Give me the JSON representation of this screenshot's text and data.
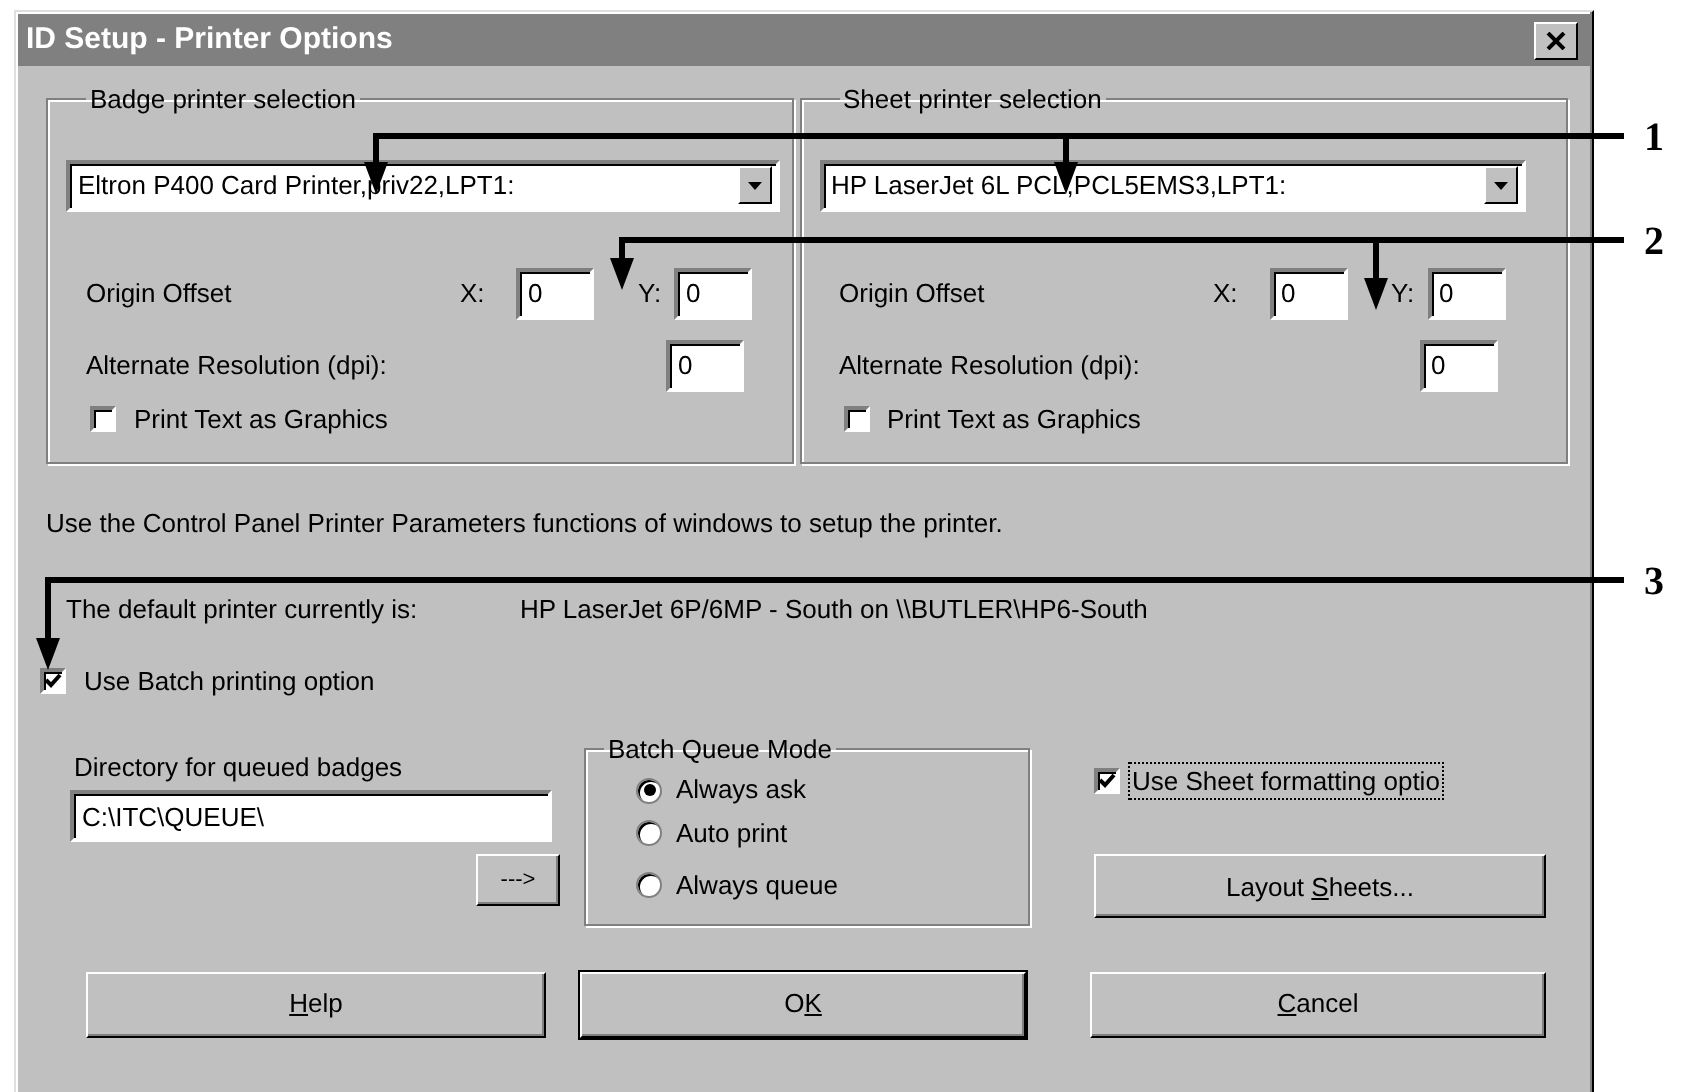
{
  "window": {
    "title": "ID Setup - Printer Options"
  },
  "printer_groups": [
    {
      "legend": "Badge printer selection",
      "printer": "Eltron P400 Card Printer,priv22,LPT1:",
      "offset_label": "Origin Offset",
      "x_label": "X:",
      "x_value": "0",
      "y_label": "Y:",
      "y_value": "0",
      "resolution_label": "Alternate Resolution (dpi):",
      "resolution_value": "0",
      "graphics_option": {
        "label": "Print Text as Graphics",
        "checked": false
      }
    },
    {
      "legend": "Sheet printer selection",
      "printer": "HP LaserJet 6L PCL,PCL5EMS3,LPT1:",
      "offset_label": "Origin Offset",
      "x_label": "X:",
      "x_value": "0",
      "y_label": "Y:",
      "y_value": "0",
      "resolution_label": "Alternate Resolution (dpi):",
      "resolution_value": "0",
      "graphics_option": {
        "label": "Print Text as Graphics",
        "checked": false
      }
    }
  ],
  "info_text": "Use the Control Panel Printer Parameters functions of windows to setup the printer.",
  "default_printer": {
    "label": "The default printer currently is:",
    "value": "HP LaserJet 6P/6MP - South on \\\\BUTLER\\HP6-South"
  },
  "batch_option": {
    "label": "Use Batch printing option",
    "checked": true
  },
  "directory": {
    "label": "Directory for queued badges",
    "value": "C:\\ITC\\QUEUE\\",
    "browse": "--->"
  },
  "queue_mode": {
    "legend": "Batch Queue Mode",
    "options": [
      {
        "label": "Always ask",
        "selected": true
      },
      {
        "label": "Auto print",
        "selected": false
      },
      {
        "label": "Always queue",
        "selected": false
      }
    ]
  },
  "sheet_option": {
    "label": "Use Sheet formatting optio",
    "checked": true,
    "focused": true
  },
  "layout_button": {
    "before": "Layout ",
    "key": "S",
    "after": "heets..."
  },
  "buttons": [
    {
      "key": "H",
      "after": "elp",
      "default": false
    },
    {
      "before": "O",
      "key": "K",
      "default": true
    },
    {
      "key": "C",
      "after": "ancel",
      "default": false
    }
  ],
  "callouts": [
    {
      "number": "1"
    },
    {
      "number": "2"
    },
    {
      "number": "3"
    }
  ]
}
